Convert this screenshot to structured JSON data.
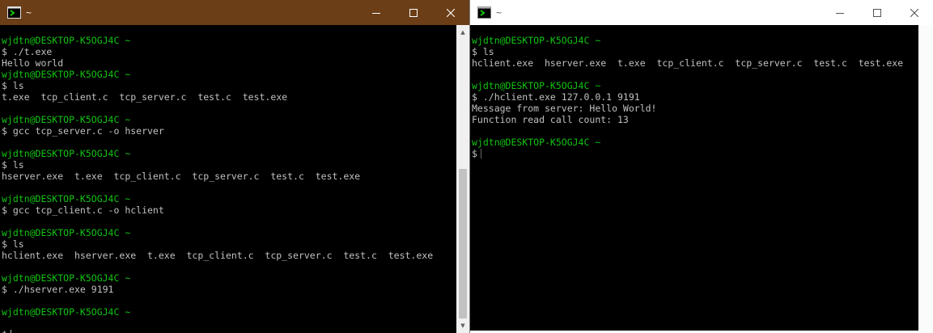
{
  "colors": {
    "left_titlebar": "#6b3e17",
    "right_titlebar": "#ffffff",
    "terminal_bg": "#000000",
    "prompt_green": "#13c413",
    "text_gray": "#c0c0c0"
  },
  "left_window": {
    "title": "~",
    "icon": "mintty-terminal-icon",
    "controls": [
      "minimize-icon",
      "maximize-icon",
      "close-icon"
    ],
    "lines": [
      {
        "text": "wjdtn@DESKTOP-K5OGJ4C ~",
        "kind": "prompt"
      },
      {
        "text": "$ ./t.exe",
        "kind": "cmd"
      },
      {
        "text": "Hello world",
        "kind": "out"
      },
      {
        "text": "wjdtn@DESKTOP-K5OGJ4C ~",
        "kind": "prompt"
      },
      {
        "text": "$ ls",
        "kind": "cmd"
      },
      {
        "text": "t.exe  tcp_client.c  tcp_server.c  test.c  test.exe",
        "kind": "out"
      },
      {
        "text": "",
        "kind": "blank"
      },
      {
        "text": "wjdtn@DESKTOP-K5OGJ4C ~",
        "kind": "prompt"
      },
      {
        "text": "$ gcc tcp_server.c -o hserver",
        "kind": "cmd"
      },
      {
        "text": "",
        "kind": "blank"
      },
      {
        "text": "wjdtn@DESKTOP-K5OGJ4C ~",
        "kind": "prompt"
      },
      {
        "text": "$ ls",
        "kind": "cmd"
      },
      {
        "text": "hserver.exe  t.exe  tcp_client.c  tcp_server.c  test.c  test.exe",
        "kind": "out"
      },
      {
        "text": "",
        "kind": "blank"
      },
      {
        "text": "wjdtn@DESKTOP-K5OGJ4C ~",
        "kind": "prompt"
      },
      {
        "text": "$ gcc tcp_client.c -o hclient",
        "kind": "cmd"
      },
      {
        "text": "",
        "kind": "blank"
      },
      {
        "text": "wjdtn@DESKTOP-K5OGJ4C ~",
        "kind": "prompt"
      },
      {
        "text": "$ ls",
        "kind": "cmd"
      },
      {
        "text": "hclient.exe  hserver.exe  t.exe  tcp_client.c  tcp_server.c  test.c  test.exe",
        "kind": "out"
      },
      {
        "text": "",
        "kind": "blank"
      },
      {
        "text": "wjdtn@DESKTOP-K5OGJ4C ~",
        "kind": "prompt"
      },
      {
        "text": "$ ./hserver.exe 9191",
        "kind": "cmd"
      },
      {
        "text": "",
        "kind": "blank"
      },
      {
        "text": "wjdtn@DESKTOP-K5OGJ4C ~",
        "kind": "prompt"
      },
      {
        "text": "",
        "kind": "blank"
      },
      {
        "text": "$",
        "kind": "cursor"
      }
    ]
  },
  "right_window": {
    "title": "~",
    "icon": "mintty-terminal-icon",
    "controls": [
      "minimize-icon",
      "maximize-icon",
      "close-icon"
    ],
    "lines": [
      {
        "text": "wjdtn@DESKTOP-K5OGJ4C ~",
        "kind": "prompt"
      },
      {
        "text": "$ ls",
        "kind": "cmd"
      },
      {
        "text": "hclient.exe  hserver.exe  t.exe  tcp_client.c  tcp_server.c  test.c  test.exe",
        "kind": "out"
      },
      {
        "text": "",
        "kind": "blank"
      },
      {
        "text": "wjdtn@DESKTOP-K5OGJ4C ~",
        "kind": "prompt"
      },
      {
        "text": "$ ./hclient.exe 127.0.0.1 9191",
        "kind": "cmd"
      },
      {
        "text": "Message from server: Hello World!",
        "kind": "out"
      },
      {
        "text": "Function read call count: 13",
        "kind": "out"
      },
      {
        "text": "",
        "kind": "blank"
      },
      {
        "text": "wjdtn@DESKTOP-K5OGJ4C ~",
        "kind": "prompt"
      },
      {
        "text": "$",
        "kind": "cursor"
      }
    ]
  },
  "scrollbar_arrows": {
    "up": "▲",
    "down": "▼"
  }
}
